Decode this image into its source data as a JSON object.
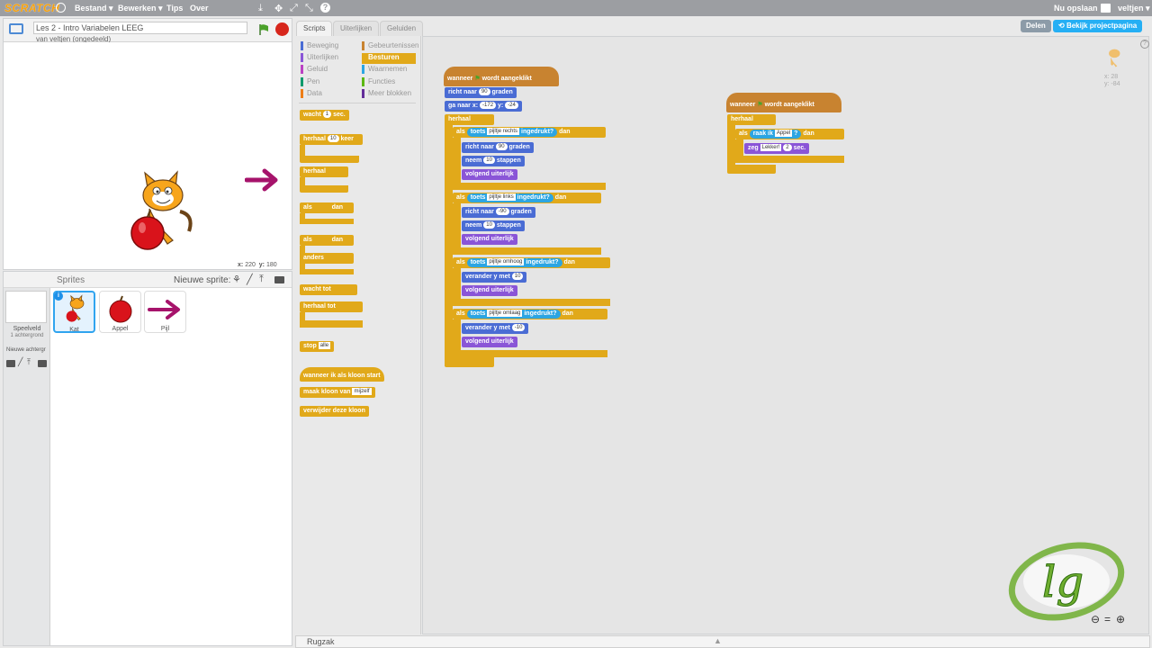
{
  "menubar": {
    "logo": "SCRATCH",
    "file": "Bestand ▾",
    "edit": "Bewerken ▾",
    "tips": "Tips",
    "about": "Over",
    "save_now": "Nu opslaan",
    "user": "veltjen ▾"
  },
  "stage": {
    "project_title": "Les 2 - Intro Variabelen LEEG",
    "by_user": "van veltjen (ongedeeld)",
    "x_label": "x:",
    "x_value": "220",
    "y_label": "y:",
    "y_value": "180"
  },
  "sprites": {
    "title": "Sprites",
    "new_sprite": "Nieuwe sprite:",
    "stage_label": "Speelveld",
    "backdrop_count": "1 achtergrond",
    "new_backdrop": "Nieuwe achtergr",
    "items": [
      {
        "name": "Kat"
      },
      {
        "name": "Appel"
      },
      {
        "name": "Pijl"
      }
    ]
  },
  "tabs": {
    "scripts": "Scripts",
    "looks": "Uiterlijken",
    "sounds": "Geluiden"
  },
  "buttons": {
    "share": "Delen",
    "project_page": "Bekijk projectpagina"
  },
  "categories": [
    "Beweging",
    "Uiterlijken",
    "Geluid",
    "Pen",
    "Data",
    "Gebeurtenissen",
    "Besturen",
    "Waarnemen",
    "Functies",
    "Meer blokken"
  ],
  "palette": {
    "wait": "wacht",
    "wait_val": "1",
    "wait_unit": "sec.",
    "repeat": "herhaal",
    "repeat_val": "10",
    "repeat_unit": "keer",
    "forever": "herhaal",
    "if": "als",
    "then": "dan",
    "else": "anders",
    "wait_until": "wacht tot",
    "repeat_until": "herhaal tot",
    "stop": "stop",
    "stop_val": "alle",
    "when_clone": "wanneer ik als kloon start",
    "create_clone": "maak kloon van",
    "clone_val": "mijzelf",
    "delete_clone": "verwijder deze kloon"
  },
  "script1": {
    "hat_a": "wanneer",
    "hat_b": "wordt aangeklikt",
    "point": "richt naar",
    "point_val": "90",
    "unit_deg": "graden",
    "goto": "ga naar x:",
    "goto_x": "-172",
    "goto_y_label": "y:",
    "goto_y": "-24",
    "forever": "herhaal",
    "if": "als",
    "key": "toets",
    "pressed": "ingedrukt?",
    "then": "dan",
    "k_right": "pijltje rechts",
    "k_left": "pijltje links",
    "k_up": "pijltje omhoog",
    "k_down": "pijltje omlaag",
    "deg_right": "90",
    "deg_left": "-90",
    "move": "neem",
    "move_val": "10",
    "move_unit": "stappen",
    "next_costume": "volgend uiterlijk",
    "change_y": "verander y met",
    "cy_up": "10",
    "cy_down": "-10"
  },
  "script2": {
    "hat_a": "wanneer",
    "hat_b": "wordt aangeklikt",
    "forever": "herhaal",
    "if": "als",
    "touching": "raak ik",
    "touch_val": "Appel",
    "q": "?",
    "then": "dan",
    "say": "zeg",
    "say_val": "Lekker!",
    "say_secs": "2",
    "say_unit": "sec."
  },
  "sprite_info": {
    "x": "x: 28",
    "y": "y: -84"
  },
  "backpack": "Rugzak",
  "colors": {
    "control": "#e1a91a",
    "motion": "#4a6cd4",
    "looks": "#8a55d7",
    "sensing": "#2ca5e2",
    "events": "#c88330",
    "share": "#8c9ba8",
    "project": "#25aff4"
  }
}
